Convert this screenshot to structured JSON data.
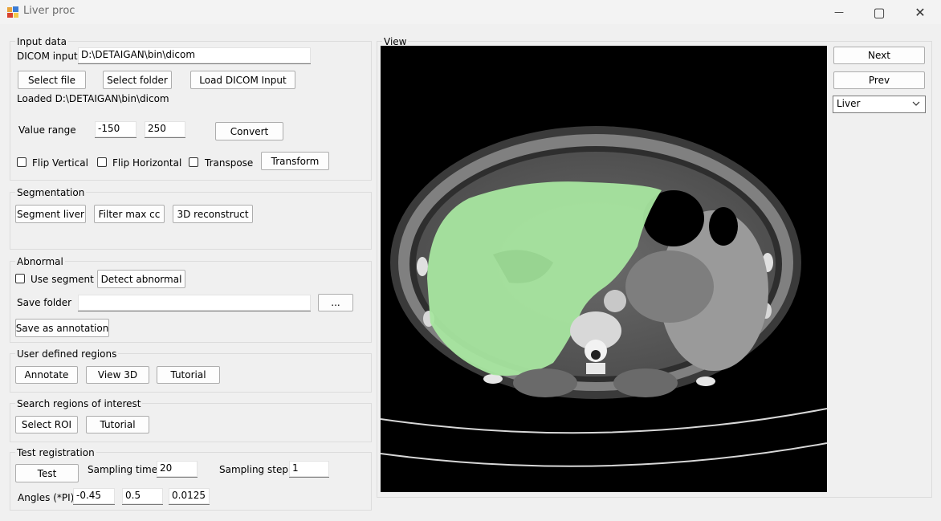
{
  "window": {
    "title": "Liver proc",
    "minimize": "—",
    "maximize": "▢",
    "close": "✕"
  },
  "input_data": {
    "group_label": "Input data",
    "dicom_label": "DICOM input",
    "dicom_value": "D:\\DETAIGAN\\bin\\dicom",
    "select_file": "Select file",
    "select_folder": "Select folder",
    "load_dicom": "Load DICOM Input",
    "loaded_status": "Loaded D:\\DETAIGAN\\bin\\dicom",
    "value_range_label": "Value range",
    "range_min": "-150",
    "range_max": "250",
    "convert": "Convert",
    "flip_vertical": "Flip Vertical",
    "flip_horizontal": "Flip Horizontal",
    "transpose": "Transpose",
    "transform": "Transform"
  },
  "segmentation": {
    "group_label": "Segmentation",
    "segment_liver": "Segment liver",
    "filter_max_cc": "Filter max cc",
    "reconstruct_3d": "3D reconstruct"
  },
  "abnormal": {
    "group_label": "Abnormal",
    "use_segment": "Use segment",
    "detect_abnormal": "Detect abnormal",
    "save_folder_label": "Save folder",
    "save_folder_value": "",
    "browse": "...",
    "save_as_annotation": "Save as annotation"
  },
  "user_regions": {
    "group_label": "User defined regions",
    "annotate": "Annotate",
    "view_3d": "View 3D",
    "tutorial": "Tutorial"
  },
  "search_roi": {
    "group_label": "Search regions of interest",
    "select_roi": "Select ROI",
    "tutorial": "Tutorial"
  },
  "test_registration": {
    "group_label": "Test registration",
    "test": "Test",
    "sampling_times_label": "Sampling times",
    "sampling_times": "20",
    "sampling_step_label": "Sampling step",
    "sampling_step": "1",
    "angles_label": "Angles (*PI)",
    "angle_1": "-0.45",
    "angle_2": "0.5",
    "angle_3": "0.0125"
  },
  "view": {
    "group_label": "View",
    "next": "Next",
    "prev": "Prev",
    "organ_selected": "Liver"
  },
  "colors": {
    "segment_overlay": "#a8e6a0",
    "background": "#f0f0f0"
  }
}
